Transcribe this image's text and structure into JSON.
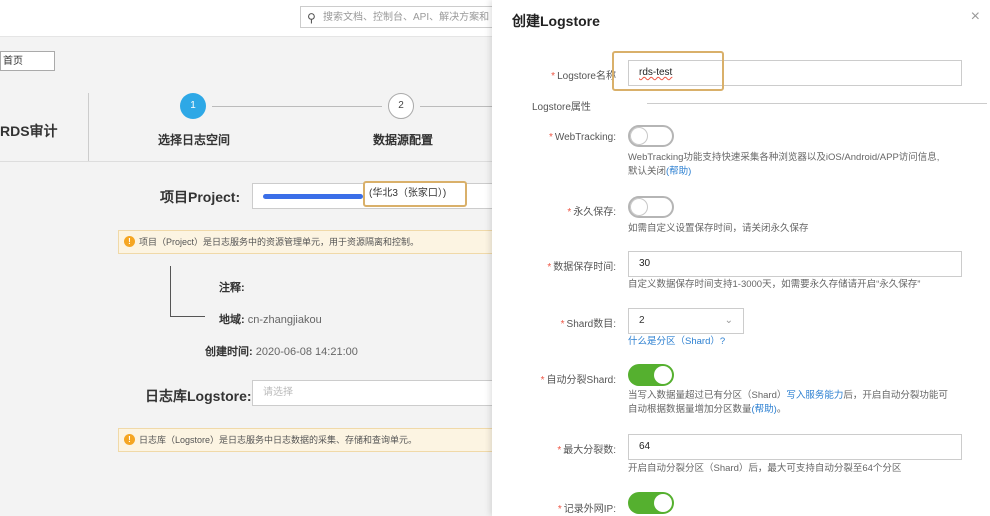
{
  "background": {
    "search_placeholder": "搜索文档、控制台、API、解决方案和",
    "home_button": "首页",
    "rds_label": "RDS审计",
    "steps": [
      {
        "number": "1",
        "label": "选择日志空间"
      },
      {
        "number": "2",
        "label": "数据源配置"
      }
    ],
    "project_label": "项目Project:",
    "project_region": "(华北3（张家口）)",
    "project_notice": "项目（Project）是日志服务中的资源管理单元，用于资源隔离和控制。",
    "remark_label": "注释:",
    "region_label": "地域:",
    "region_value": "cn-zhangjiakou",
    "created_label": "创建时间:",
    "created_value": "2020-06-08 14:21:00",
    "logstore_label": "日志库Logstore:",
    "logstore_placeholder": "请选择",
    "logstore_notice": "日志库（Logstore）是日志服务中日志数据的采集、存储和查询单元。"
  },
  "panel": {
    "title": "创建Logstore",
    "close": "×",
    "logstore_name_label": "Logstore名称",
    "logstore_name_value": "rds-test",
    "section_label": "Logstore属性",
    "webtracking_label": "WebTracking:",
    "webtracking_help": "WebTracking功能支持快速采集各种浏览器以及iOS/Android/APP访问信息,",
    "webtracking_help2": "默认关闭",
    "webtracking_help_link": "(帮助)",
    "permanent_label": "永久保存:",
    "permanent_help": "如需自定义设置保存时间，请关闭永久保存",
    "retention_label": "数据保存时间:",
    "retention_value": "30",
    "retention_help": "自定义数据保存时间支持1-3000天，如需要永久存储请开启“永久保存”",
    "shard_label": "Shard数目:",
    "shard_value": "2",
    "shard_link": "什么是分区（Shard）?",
    "autosplit_label": "自动分裂Shard:",
    "autosplit_help_a": "当写入数据量超过已有分区（Shard）",
    "autosplit_help_link1": "写入服务能力",
    "autosplit_help_b": "后，开启自动分裂功能可",
    "autosplit_help_c": "自动根据数据量增加分区数量",
    "autosplit_help_link2": "(帮助)",
    "autosplit_help_d": "。",
    "max_split_label": "最大分裂数:",
    "max_split_value": "64",
    "max_split_help": "开启自动分裂分区（Shard）后，最大可支持自动分裂至64个分区",
    "record_ip_label": "记录外网IP:"
  }
}
